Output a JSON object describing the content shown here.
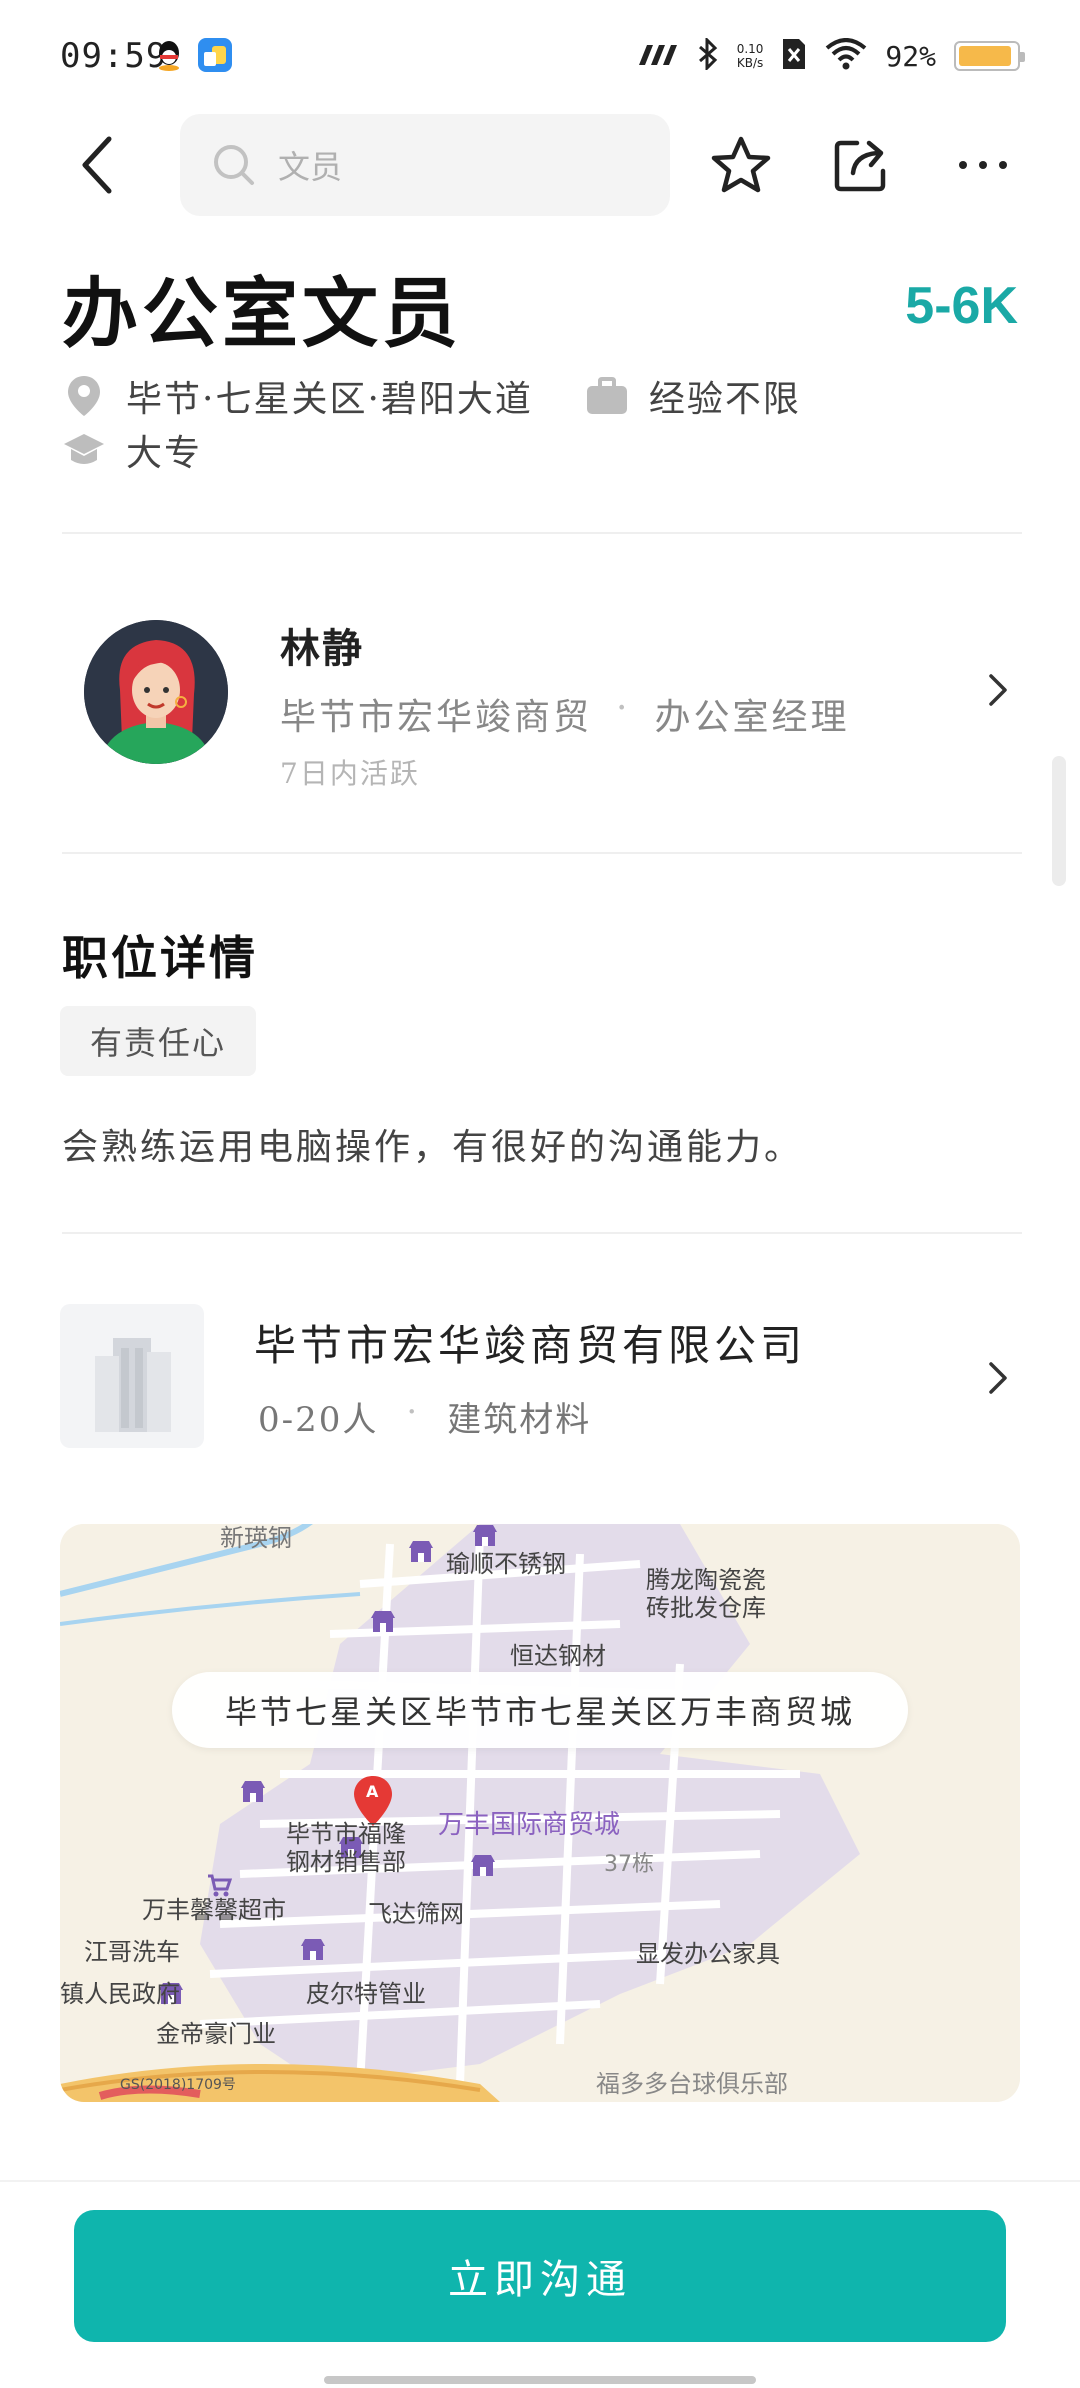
{
  "status_bar": {
    "time": "09:59",
    "network_speed_value": "0.10",
    "network_speed_unit": "KB/s",
    "battery_percent": "92%",
    "battery_level": 0.92,
    "icons": [
      "qq-icon",
      "app-icon",
      "signal-5g-icon",
      "bluetooth-icon",
      "sim-off-icon",
      "wifi-icon",
      "battery-icon"
    ]
  },
  "header": {
    "search_placeholder": "文员",
    "icons": [
      "back-icon",
      "search-icon",
      "star-icon",
      "share-icon",
      "more-icon"
    ]
  },
  "job": {
    "title": "办公室文员",
    "salary": "5-6K",
    "location": "毕节·七星关区·碧阳大道",
    "experience": "经验不限",
    "education": "大专"
  },
  "recruiter": {
    "name": "林静",
    "company": "毕节市宏华竣商贸",
    "separator": "·",
    "position": "办公室经理",
    "active": "7日内活跃"
  },
  "details": {
    "section_title": "职位详情",
    "tags": [
      "有责任心"
    ],
    "description": "会熟练运用电脑操作，有很好的沟通能力。"
  },
  "company": {
    "name": "毕节市宏华竣商贸有限公司",
    "size": "0-20人",
    "separator": "·",
    "industry": "建筑材料"
  },
  "map": {
    "address": "毕节七星关区毕节市七星关区万丰商贸城",
    "labels": {
      "top_cut": "新瑛钢",
      "yushun": "瑜顺不锈钢",
      "tenglong_1": "腾龙陶瓷瓷",
      "tenglong_2": "砖批发仓库",
      "hengda": "恒达钢材",
      "wanfeng_plaza": "万丰国际商贸城",
      "bijie_1": "毕节市福隆",
      "bijie_2": "钢材销售部",
      "building": "37栋",
      "supermarket": "万丰馨馨超市",
      "feida": "飞达筛网",
      "carwash": "江哥洗车",
      "xianfa": "显发办公家具",
      "town_gov": "镇人民政府",
      "pierte": "皮尔特管业",
      "jindi": "金帝豪门业",
      "billiards": "福多多台球俱乐部",
      "copyright": "GS(2018)1709号",
      "marker": "A"
    }
  },
  "cta": {
    "chat_label": "立即沟通"
  },
  "colors": {
    "accent": "#0fb5ad",
    "salary": "#1aa9a6",
    "battery": "#f6b94a"
  }
}
